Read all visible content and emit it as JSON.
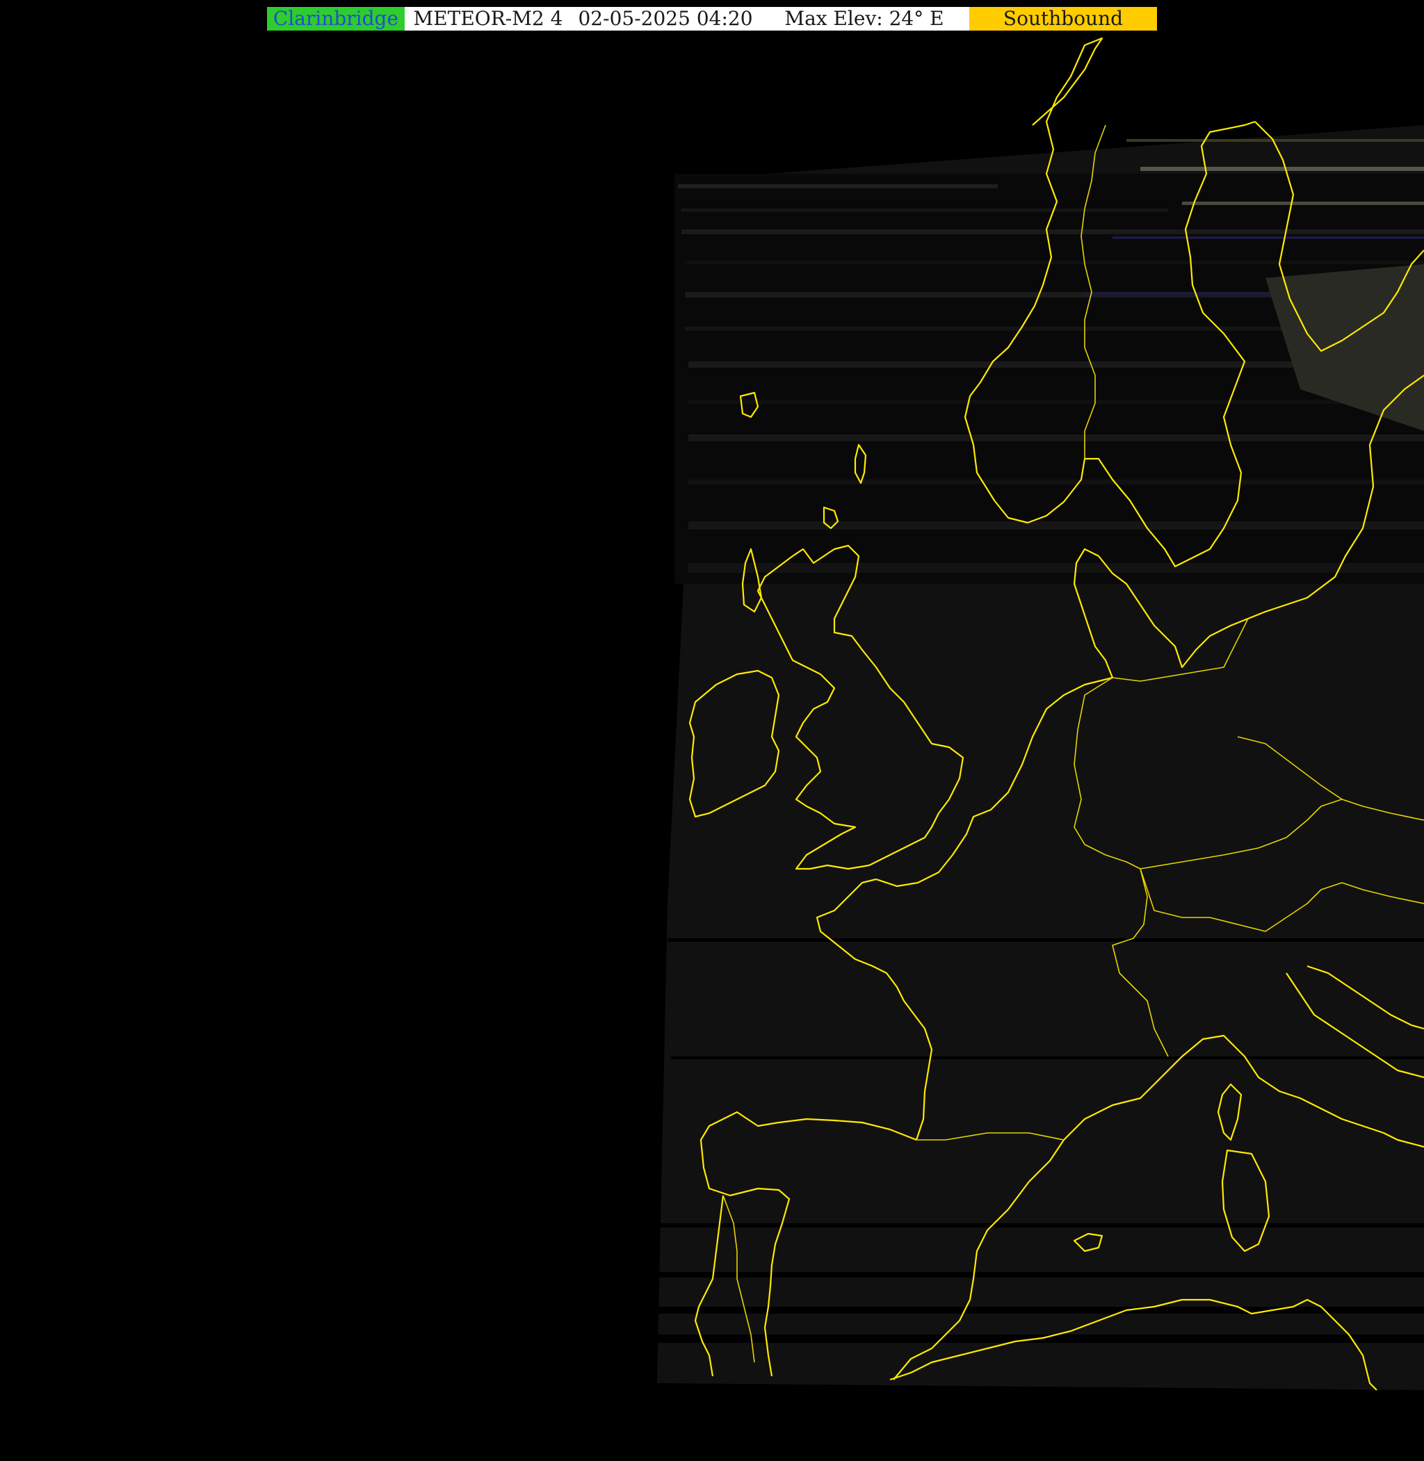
{
  "header": {
    "station": "Clarinbridge",
    "satellite": "METEOR-M2 4",
    "datetime": "02-05-2025 04:20",
    "max_elevation": "Max Elev: 24° E",
    "direction": "Southbound"
  },
  "colors": {
    "station_bg": "#2ecc2e",
    "station_text": "#1f4fd0",
    "direction_bg": "#ffcc00",
    "header_bg": "#ffffff",
    "background": "#000000",
    "swath": "#111111",
    "coastline": "#ffea00"
  },
  "map": {
    "description_icon": "satellite-swath-image",
    "overlay": "coastlines-and-borders"
  }
}
